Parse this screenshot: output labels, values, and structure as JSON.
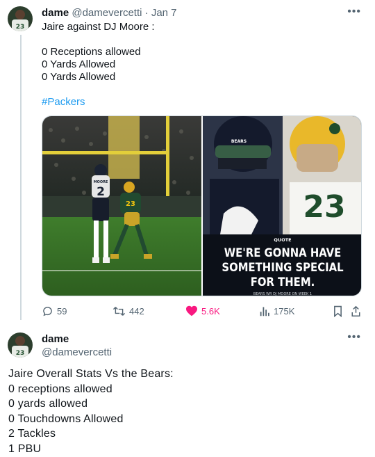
{
  "tweet1": {
    "display_name": "dame",
    "handle": "@damevercetti",
    "separator": "·",
    "date": "Jan 7",
    "more_icon": "more-dots-icon",
    "lines": [
      "Jaire against DJ Moore :",
      "",
      "0 Receptions allowed",
      "0 Yards Allowed",
      "0 Yards Allowed",
      ""
    ],
    "hashtag": "#Packers",
    "media": {
      "left_jersey_name": "MOORE",
      "left_jersey_number": "2",
      "right_jersey_number": "23",
      "quote_label": "QUOTE",
      "quote_lines": [
        "WE'RE GONNA HAVE",
        "SOMETHING SPECIAL",
        "FOR THEM."
      ],
      "quote_credit": "BEARS WR DJ MOORE ON WEEK 1"
    },
    "actions": {
      "replies": "59",
      "reposts": "442",
      "likes": "5.6K",
      "views": "175K"
    },
    "colors": {
      "like": "#f91880",
      "hashtag": "#1d9bf0",
      "muted": "#536471"
    }
  },
  "tweet2": {
    "display_name": "dame",
    "handle": "@damevercetti",
    "more_icon": "more-dots-icon",
    "lines": [
      "Jaire Overall Stats Vs the Bears:",
      "0 receptions allowed",
      "0 yards allowed",
      "0 Touchdowns Allowed",
      "2 Tackles",
      "1 PBU"
    ]
  }
}
